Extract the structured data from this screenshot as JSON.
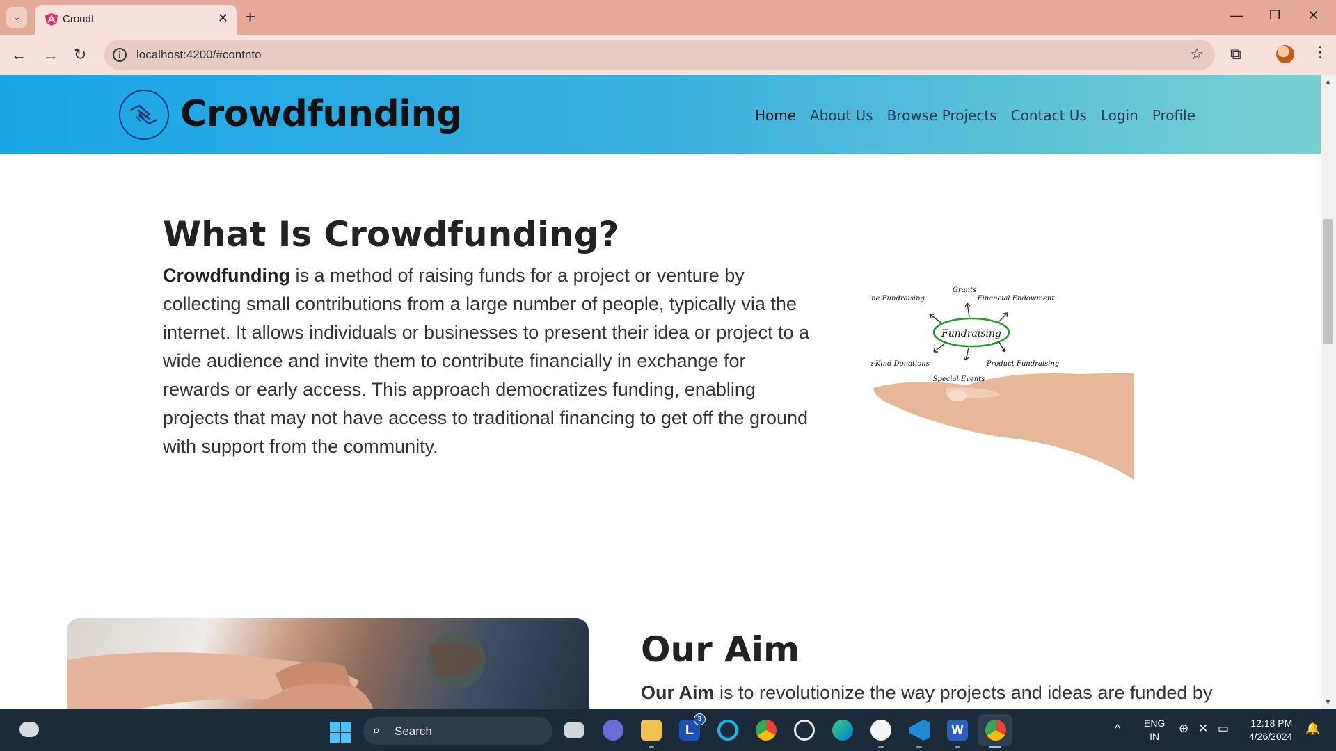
{
  "browser": {
    "tab_title": "Croudf",
    "url": "localhost:4200/#contnto",
    "colors": {
      "tabbar": "#e4a999",
      "toolbar": "#f8e1da"
    }
  },
  "site": {
    "brand": "Crowdfunding",
    "nav": [
      "Home",
      "About Us",
      "Browse Projects",
      "Contact Us",
      "Login",
      "Profile"
    ],
    "active_nav": "Home"
  },
  "intro": {
    "title": "What Is Crowdfunding?",
    "lead_bold": "Crowdfunding",
    "text": " is a method of raising funds for a project or venture by collecting small contributions from a large number of people, typically via the internet. It allows individuals or businesses to present their idea or project to a wide audience and invite them to contribute financially in exchange for rewards or early access. This approach democratizes funding, enabling projects that may not have access to traditional financing to get off the ground with support from the community.",
    "diagram": {
      "center": "Fundraising",
      "items": [
        "Online Fundraising",
        "Grants",
        "Financial Endowment",
        "In-Kind Donations",
        "Special Events",
        "Product Fundraising"
      ]
    }
  },
  "aim": {
    "title": "Our Aim",
    "lead_bold": "Our Aim",
    "text": " is to revolutionize the way projects and ideas are funded by"
  },
  "taskbar": {
    "search_label": "Search",
    "lang_line1": "ENG",
    "lang_line2": "IN",
    "time": "12:18 PM",
    "date": "4/26/2024",
    "badge_count": "3"
  }
}
